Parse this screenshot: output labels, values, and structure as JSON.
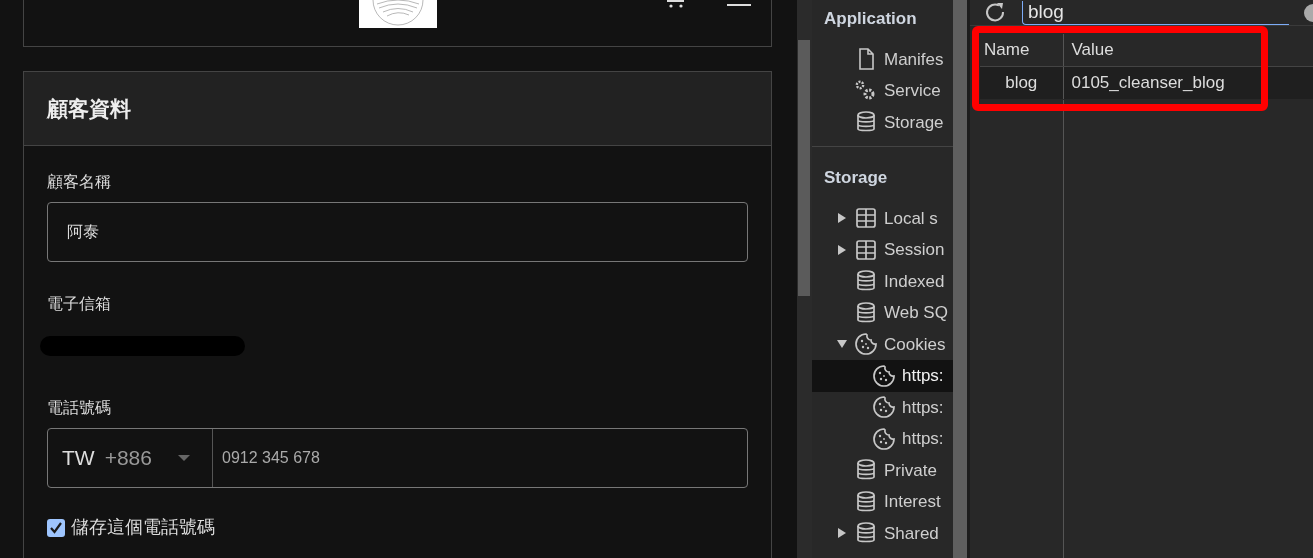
{
  "page": {
    "section_title": "顧客資料",
    "fields": [
      {
        "kind": "text",
        "label": "顧客名稱",
        "value": "阿泰"
      },
      {
        "kind": "redacted",
        "label": "電子信箱"
      },
      {
        "kind": "phone",
        "label": "電話號碼",
        "country": "TW",
        "dial_code": "+886",
        "placeholder": "0912 345 678"
      }
    ],
    "save_phone": {
      "label": "儲存這個電話號碼",
      "checked": true
    }
  },
  "devtools": {
    "sections": [
      {
        "title": "Application",
        "items": [
          {
            "label": "Manifes",
            "kind": "file",
            "selected": false
          },
          {
            "label": "Service",
            "kind": "gears",
            "selected": false
          },
          {
            "label": "Storage",
            "kind": "database",
            "selected": false
          }
        ]
      },
      {
        "title": "Storage",
        "items": [
          {
            "label": "Local s",
            "kind": "table",
            "expanded": false,
            "selected": false
          },
          {
            "label": "Session",
            "kind": "table",
            "expanded": false,
            "selected": false
          },
          {
            "label": "Indexed",
            "kind": "database",
            "selected": false
          },
          {
            "label": "Web SQ",
            "kind": "database",
            "selected": false
          },
          {
            "label": "Cookies",
            "kind": "cookie",
            "expanded": true,
            "selected": false,
            "children": [
              {
                "label": "https:",
                "kind": "cookie",
                "selected": true
              },
              {
                "label": "https:",
                "kind": "cookie",
                "selected": false
              },
              {
                "label": "https:",
                "kind": "cookie",
                "selected": false
              }
            ]
          },
          {
            "label": "Private",
            "kind": "database",
            "selected": false
          },
          {
            "label": "Interest",
            "kind": "database",
            "selected": false
          },
          {
            "label": "Shared",
            "kind": "database",
            "expanded": false,
            "selected": false
          }
        ]
      }
    ],
    "filter": {
      "value": "blog"
    },
    "table": {
      "columns": [
        "Name",
        "Value"
      ],
      "rows": [
        {
          "cells": [
            "blog",
            "0105_cleanser_blog"
          ]
        }
      ]
    }
  }
}
